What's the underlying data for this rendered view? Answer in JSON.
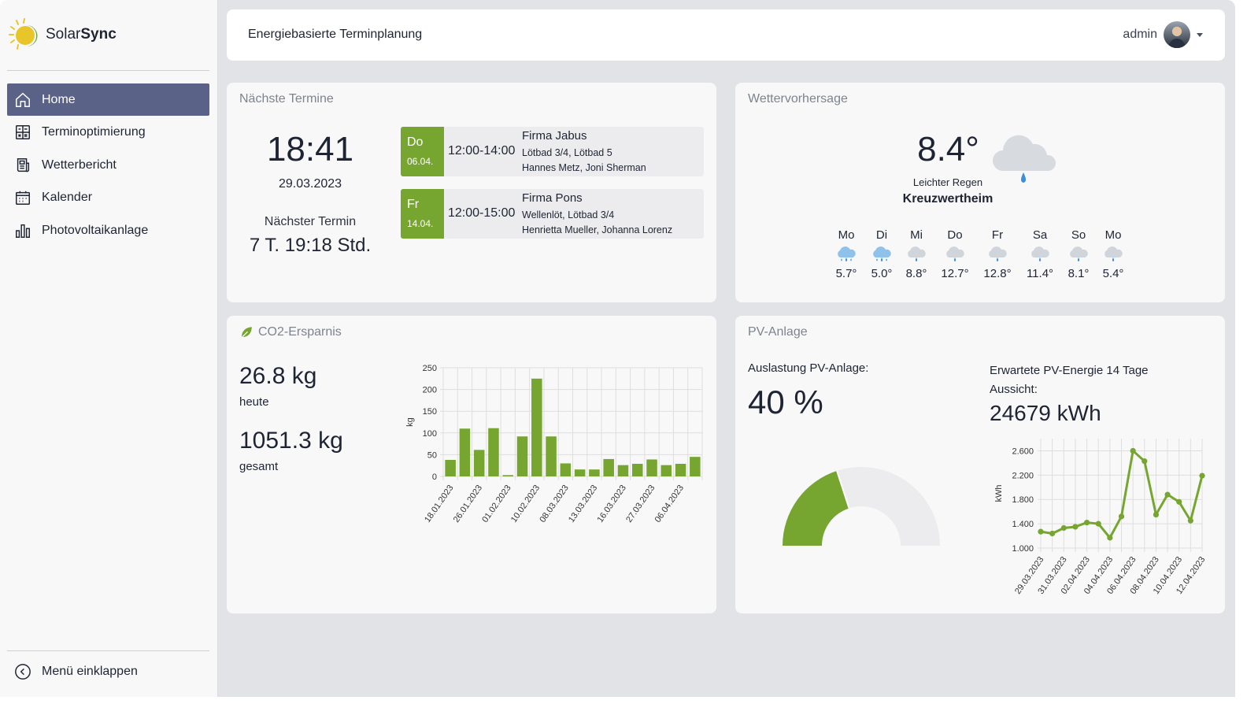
{
  "app": {
    "name_part1": "Solar",
    "name_part2": "Sync"
  },
  "sidebar": {
    "items": [
      {
        "label": "Home",
        "icon": "home-icon",
        "active": true
      },
      {
        "label": "Terminoptimierung",
        "icon": "calculator-icon"
      },
      {
        "label": "Wetterbericht",
        "icon": "newspaper-icon"
      },
      {
        "label": "Kalender",
        "icon": "calendar-icon"
      },
      {
        "label": "Photovoltaikanlage",
        "icon": "bar-chart-icon"
      }
    ],
    "collapse_label": "Menü einklappen"
  },
  "header": {
    "title": "Energiebasierte Terminplanung",
    "user": "admin"
  },
  "appointments": {
    "title": "Nächste Termine",
    "time": "18:41",
    "date": "29.03.2023",
    "next_label": "Nächster Termin",
    "next_value": "7 T. 19:18 Std.",
    "items": [
      {
        "day": "Do",
        "date": "06.04.",
        "time": "12:00-14:00",
        "company": "Firma Jabus",
        "rooms": "Lötbad 3/4, Lötbad 5",
        "people": "Hannes Metz, Joni Sherman"
      },
      {
        "day": "Fr",
        "date": "14.04.",
        "time": "12:00-15:00",
        "company": "Firma Pons",
        "rooms": "Wellenlöt, Lötbad 3/4",
        "people": "Henrietta Mueller, Johanna Lorenz"
      }
    ]
  },
  "weather": {
    "title": "Wettervorhersage",
    "temp": "8.4°",
    "condition": "Leichter Regen",
    "city": "Kreuzwertheim",
    "forecast": [
      {
        "day": "Mo",
        "temp": "5.7°",
        "icon": "rain-cloud-icon"
      },
      {
        "day": "Di",
        "temp": "5.0°",
        "icon": "rain-cloud-icon"
      },
      {
        "day": "Mi",
        "temp": "8.8°",
        "icon": "drizzle-cloud-icon"
      },
      {
        "day": "Do",
        "temp": "12.7°",
        "icon": "drizzle-cloud-icon"
      },
      {
        "day": "Fr",
        "temp": "12.8°",
        "icon": "drizzle-cloud-icon"
      },
      {
        "day": "Sa",
        "temp": "11.4°",
        "icon": "drizzle-cloud-icon"
      },
      {
        "day": "So",
        "temp": "8.1°",
        "icon": "drizzle-cloud-icon"
      },
      {
        "day": "Mo",
        "temp": "5.4°",
        "icon": "drizzle-cloud-icon"
      }
    ]
  },
  "co2": {
    "title": "CO2-Ersparnis",
    "today_value": "26.8 kg",
    "today_label": "heute",
    "total_value": "1051.3 kg",
    "total_label": "gesamt"
  },
  "pv": {
    "title": "PV-Anlage",
    "util_label": "Auslastung PV-Anlage:",
    "util_value": "40 %",
    "util_fraction": 0.4,
    "expected_label": "Erwartete PV-Energie 14 Tage Aussicht:",
    "expected_value": "24679 kWh"
  },
  "colors": {
    "accent": "#76a530",
    "nav_active": "#5b6288",
    "bg": "#e2e3e7"
  },
  "chart_data": [
    {
      "type": "bar",
      "ylabel": "kg",
      "ylim": [
        0,
        250
      ],
      "yticks": [
        0,
        50,
        100,
        150,
        200,
        250
      ],
      "tick_labels": [
        "18.01.2023",
        "26.01.2023",
        "01.02.2023",
        "10.02.2023",
        "08.03.2023",
        "13.03.2023",
        "16.03.2023",
        "27.03.2023",
        "06.04.2023"
      ],
      "values": [
        38,
        110,
        61,
        111,
        3,
        92,
        225,
        92,
        30,
        16,
        16,
        40,
        26,
        29,
        39,
        26,
        29,
        45
      ],
      "color": "#76a530",
      "grid": true
    },
    {
      "type": "line",
      "ylabel": "kWh",
      "ylim": [
        1000,
        2800
      ],
      "yticks": [
        1000,
        1400,
        1800,
        2200,
        2600
      ],
      "ytick_labels": [
        "1.000",
        "1.400",
        "1.800",
        "2.200",
        "2.600"
      ],
      "x": [
        "29.03.2023",
        "30.03.2023",
        "31.03.2023",
        "01.04.2023",
        "02.04.2023",
        "03.04.2023",
        "04.04.2023",
        "05.04.2023",
        "06.04.2023",
        "07.04.2023",
        "08.04.2023",
        "09.04.2023",
        "10.04.2023",
        "11.04.2023",
        "12.04.2023"
      ],
      "tick_labels": [
        "29.03.2023",
        "31.03.2023",
        "02.04.2023",
        "04.04.2023",
        "06.04.2023",
        "08.04.2023",
        "10.04.2023",
        "12.04.2023"
      ],
      "values": [
        1270,
        1240,
        1330,
        1350,
        1420,
        1400,
        1170,
        1520,
        2600,
        2430,
        1550,
        1880,
        1760,
        1450,
        2190
      ],
      "color": "#76a530",
      "grid": true
    }
  ]
}
